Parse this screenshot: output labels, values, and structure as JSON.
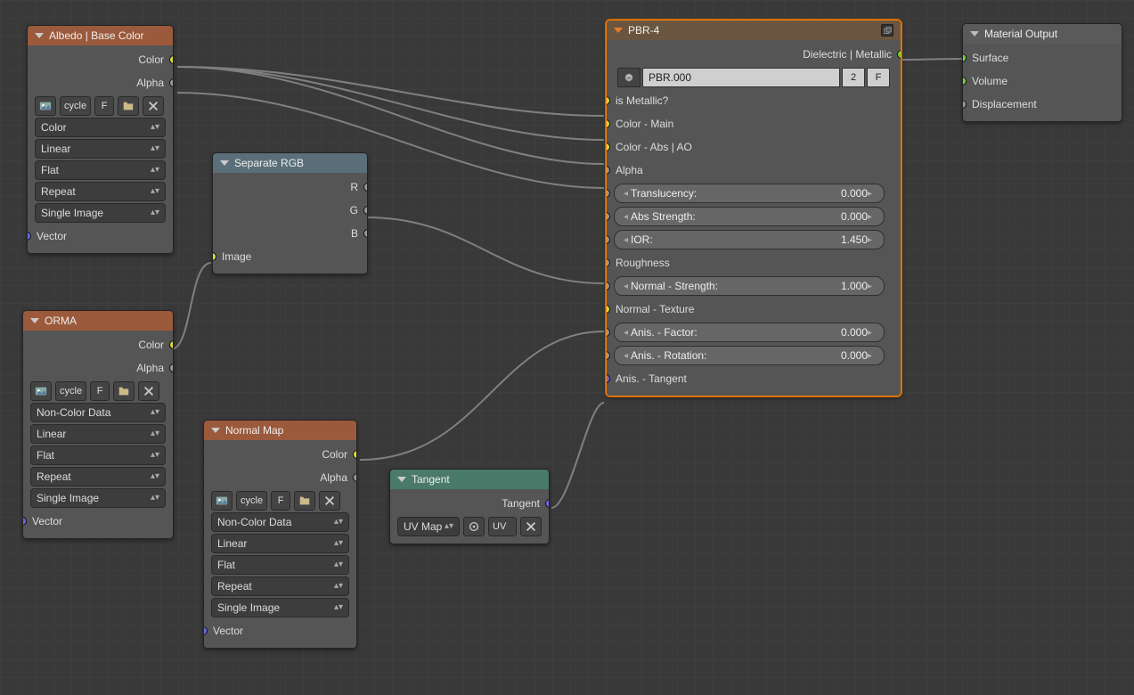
{
  "albedo": {
    "title": "Albedo | Base Color",
    "out_color": "Color",
    "out_alpha": "Alpha",
    "btn_cycle": "cycle",
    "btn_f": "F",
    "sel_color": "Color",
    "sel_interp": "Linear",
    "sel_proj": "Flat",
    "sel_ext": "Repeat",
    "sel_source": "Single Image",
    "in_vector": "Vector"
  },
  "orma": {
    "title": "ORMA",
    "out_color": "Color",
    "out_alpha": "Alpha",
    "btn_cycle": "cycle",
    "btn_f": "F",
    "sel_color": "Non-Color Data",
    "sel_interp": "Linear",
    "sel_proj": "Flat",
    "sel_ext": "Repeat",
    "sel_source": "Single Image",
    "in_vector": "Vector"
  },
  "normal": {
    "title": "Normal Map",
    "out_color": "Color",
    "out_alpha": "Alpha",
    "btn_cycle": "cycle",
    "btn_f": "F",
    "sel_color": "Non-Color Data",
    "sel_interp": "Linear",
    "sel_proj": "Flat",
    "sel_ext": "Repeat",
    "sel_source": "Single Image",
    "in_vector": "Vector"
  },
  "seprgb": {
    "title": "Separate RGB",
    "out_r": "R",
    "out_g": "G",
    "out_b": "B",
    "in_image": "Image"
  },
  "tangent": {
    "title": "Tangent",
    "out_tangent": "Tangent",
    "sel_mode": "UV Map",
    "txt_uv": "UV"
  },
  "pbr": {
    "title": "PBR-4",
    "out_main": "Dielectric | Metallic",
    "mat_name": "PBR.000",
    "mat_users": "2",
    "mat_fake": "F",
    "in_metallic": "is Metallic?",
    "in_color_main": "Color - Main",
    "in_color_abs": "Color - Abs | AO",
    "in_alpha": "Alpha",
    "prop_transl": "Translucency:",
    "prop_transl_v": "0.000",
    "prop_abs": "Abs Strength:",
    "prop_abs_v": "0.000",
    "prop_ior": "IOR:",
    "prop_ior_v": "1.450",
    "in_roughness": "Roughness",
    "prop_nstr": "Normal - Strength:",
    "prop_nstr_v": "1.000",
    "in_ntex": "Normal - Texture",
    "prop_anisf": "Anis. - Factor:",
    "prop_anisf_v": "0.000",
    "prop_anisr": "Anis. - Rotation:",
    "prop_anisr_v": "0.000",
    "in_atang": "Anis. - Tangent"
  },
  "output": {
    "title": "Material Output",
    "in_surface": "Surface",
    "in_volume": "Volume",
    "in_disp": "Displacement"
  }
}
